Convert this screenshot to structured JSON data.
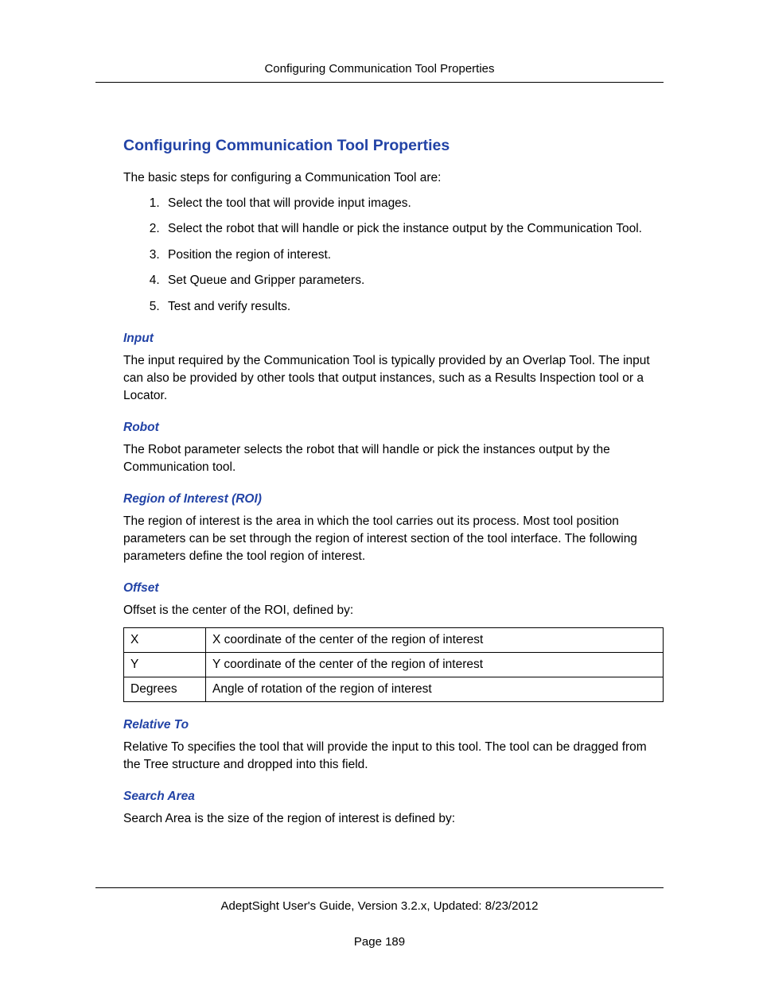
{
  "header": {
    "running_title": "Configuring Communication Tool Properties"
  },
  "title": "Configuring Communication Tool Properties",
  "intro": "The basic steps for configuring a Communication Tool are:",
  "steps": [
    "Select the tool that will provide input images.",
    "Select the robot that will handle or pick the instance output by the Communication Tool.",
    "Position the region of interest.",
    "Set Queue and Gripper parameters.",
    "Test and verify results."
  ],
  "sections": {
    "input": {
      "heading": "Input",
      "body": "The input required by the Communication Tool is typically provided by an Overlap Tool. The input can also be provided by other tools that output instances, such as a Results Inspection tool or a Locator."
    },
    "robot": {
      "heading": "Robot",
      "body": "The Robot parameter selects the robot that will handle or pick the instances output by the Communication tool."
    },
    "roi": {
      "heading": "Region of Interest (ROI)",
      "body": "The region of interest is the area in which the tool carries out its process. Most tool position parameters can be set through the region of interest section of the tool interface. The following parameters define the tool region of interest."
    },
    "offset": {
      "heading": "Offset",
      "body": "Offset is the center of the ROI, defined by:",
      "table": [
        {
          "label": "X",
          "desc": "X coordinate of the center of the region of interest"
        },
        {
          "label": "Y",
          "desc": "Y coordinate of the center of the region of interest"
        },
        {
          "label": "Degrees",
          "desc": "Angle of rotation of the region of interest"
        }
      ]
    },
    "relative_to": {
      "heading": "Relative To",
      "body": "Relative To specifies the tool that will provide the input to this tool. The tool can be dragged from the Tree structure and dropped into this field."
    },
    "search_area": {
      "heading": "Search Area",
      "body": "Search Area is the size of the region of interest is defined by:"
    }
  },
  "footer": {
    "doc_info": "AdeptSight User's Guide,  Version 3.2.x, Updated: 8/23/2012",
    "page": "Page 189"
  }
}
